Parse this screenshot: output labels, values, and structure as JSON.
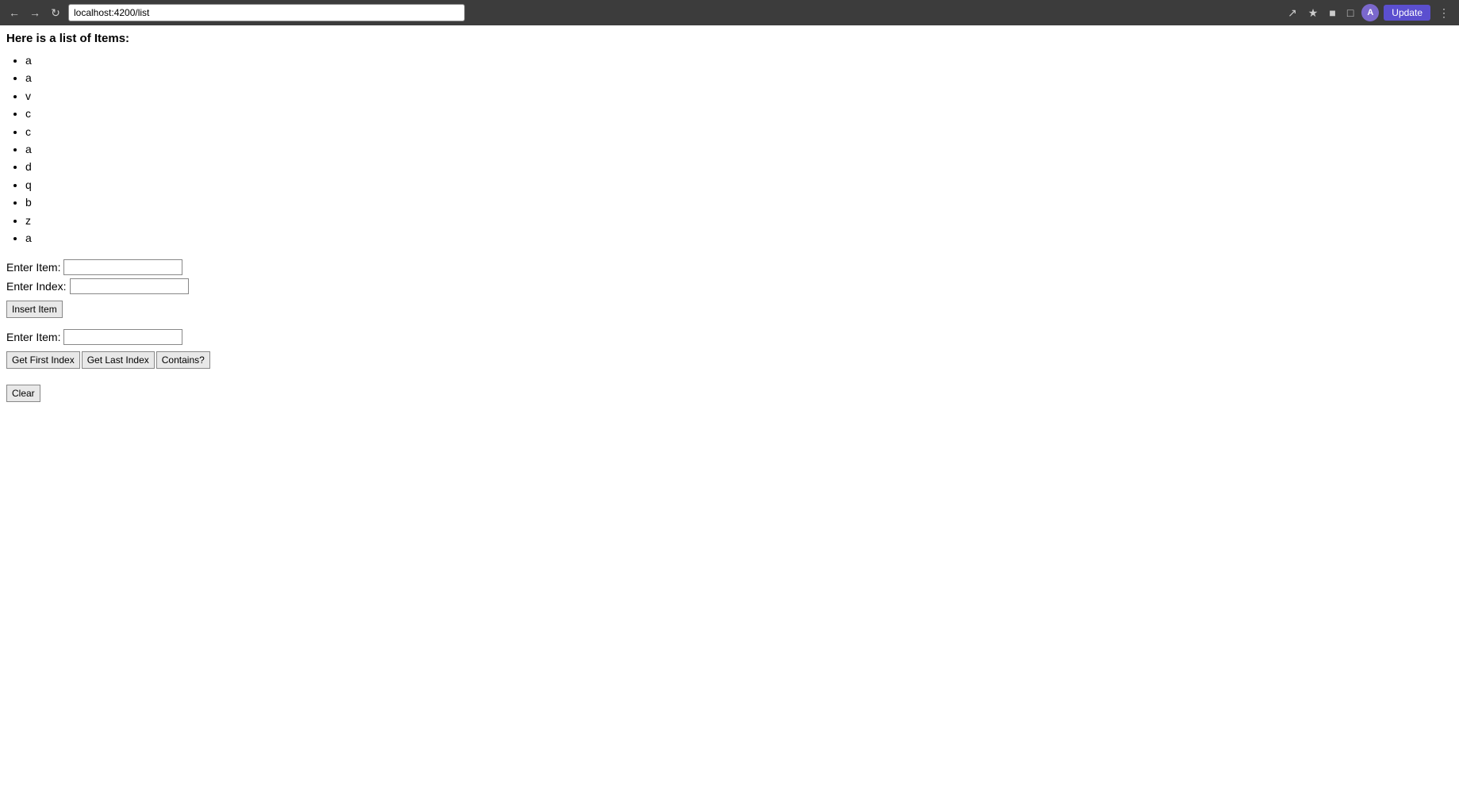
{
  "browser": {
    "url": "localhost:4200/list",
    "update_label": "Update",
    "avatar_label": "A"
  },
  "page": {
    "title": "Here is a list of Items:",
    "items": [
      "a",
      "a",
      "v",
      "c",
      "c",
      "a",
      "d",
      "q",
      "b",
      "z",
      "a"
    ]
  },
  "insert_form": {
    "item_label": "Enter Item:",
    "index_label": "Enter Index:",
    "insert_button_label": "Insert Item",
    "item_value": "",
    "index_value": ""
  },
  "search_form": {
    "item_label": "Enter Item:",
    "first_index_button_label": "Get First Index",
    "last_index_button_label": "Get Last Index",
    "contains_button_label": "Contains?",
    "item_value": ""
  },
  "clear_section": {
    "clear_button_label": "Clear"
  }
}
